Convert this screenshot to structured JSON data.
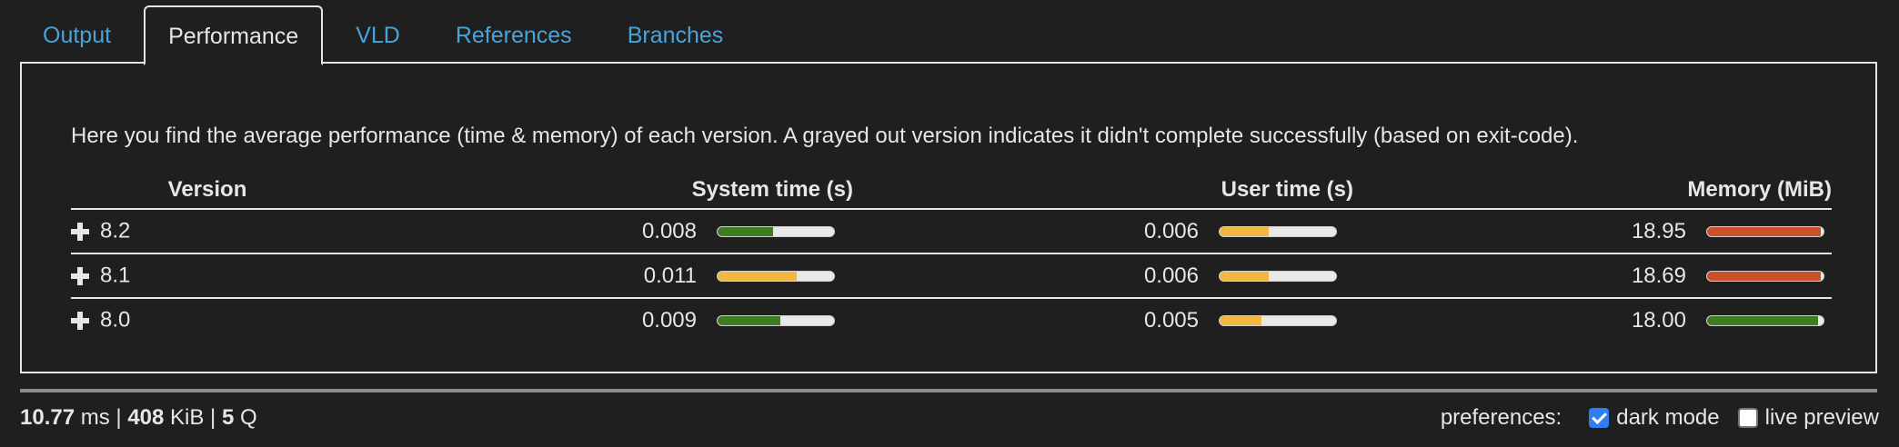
{
  "tabs": [
    {
      "label": "Output",
      "active": false
    },
    {
      "label": "Performance",
      "active": true
    },
    {
      "label": "VLD",
      "active": false
    },
    {
      "label": "References",
      "active": false
    },
    {
      "label": "Branches",
      "active": false
    }
  ],
  "panel": {
    "intro": "Here you find the average performance (time & memory) of each version. A grayed out version indicates it didn't complete successfully (based on exit-code).",
    "headers": {
      "version": "Version",
      "system_time": "System time (s)",
      "user_time": "User time (s)",
      "memory": "Memory (MiB)"
    },
    "rows": [
      {
        "version": "8.2",
        "system_time": "0.008",
        "system_fraction": 0.48,
        "system_color": "#3e7d22",
        "user_time": "0.006",
        "user_fraction": 0.42,
        "user_color": "#f0b840",
        "memory": "18.95",
        "memory_fraction": 0.98,
        "memory_color": "#c8502a"
      },
      {
        "version": "8.1",
        "system_time": "0.011",
        "system_fraction": 0.68,
        "system_color": "#f0b840",
        "user_time": "0.006",
        "user_fraction": 0.42,
        "user_color": "#f0b840",
        "memory": "18.69",
        "memory_fraction": 0.98,
        "memory_color": "#c8502a"
      },
      {
        "version": "8.0",
        "system_time": "0.009",
        "system_fraction": 0.54,
        "system_color": "#3e7d22",
        "user_time": "0.005",
        "user_fraction": 0.36,
        "user_color": "#f0b840",
        "memory": "18.00",
        "memory_fraction": 0.95,
        "memory_color": "#3e7d22"
      }
    ]
  },
  "footer": {
    "time_value": "10.77",
    "time_unit": " ms",
    "sep1": " | ",
    "memory_value": "408",
    "memory_unit": " KiB",
    "sep2": " | ",
    "queries_value": "5",
    "queries_unit": " Q",
    "preferences_label": "preferences:",
    "dark_mode_label": "dark mode",
    "dark_mode_checked": true,
    "live_preview_label": "live preview",
    "live_preview_checked": false
  },
  "icons": {
    "expand": "plus-icon",
    "checkbox_checked": "checkbox-checked-icon",
    "checkbox_unchecked": "checkbox-unchecked-icon"
  }
}
